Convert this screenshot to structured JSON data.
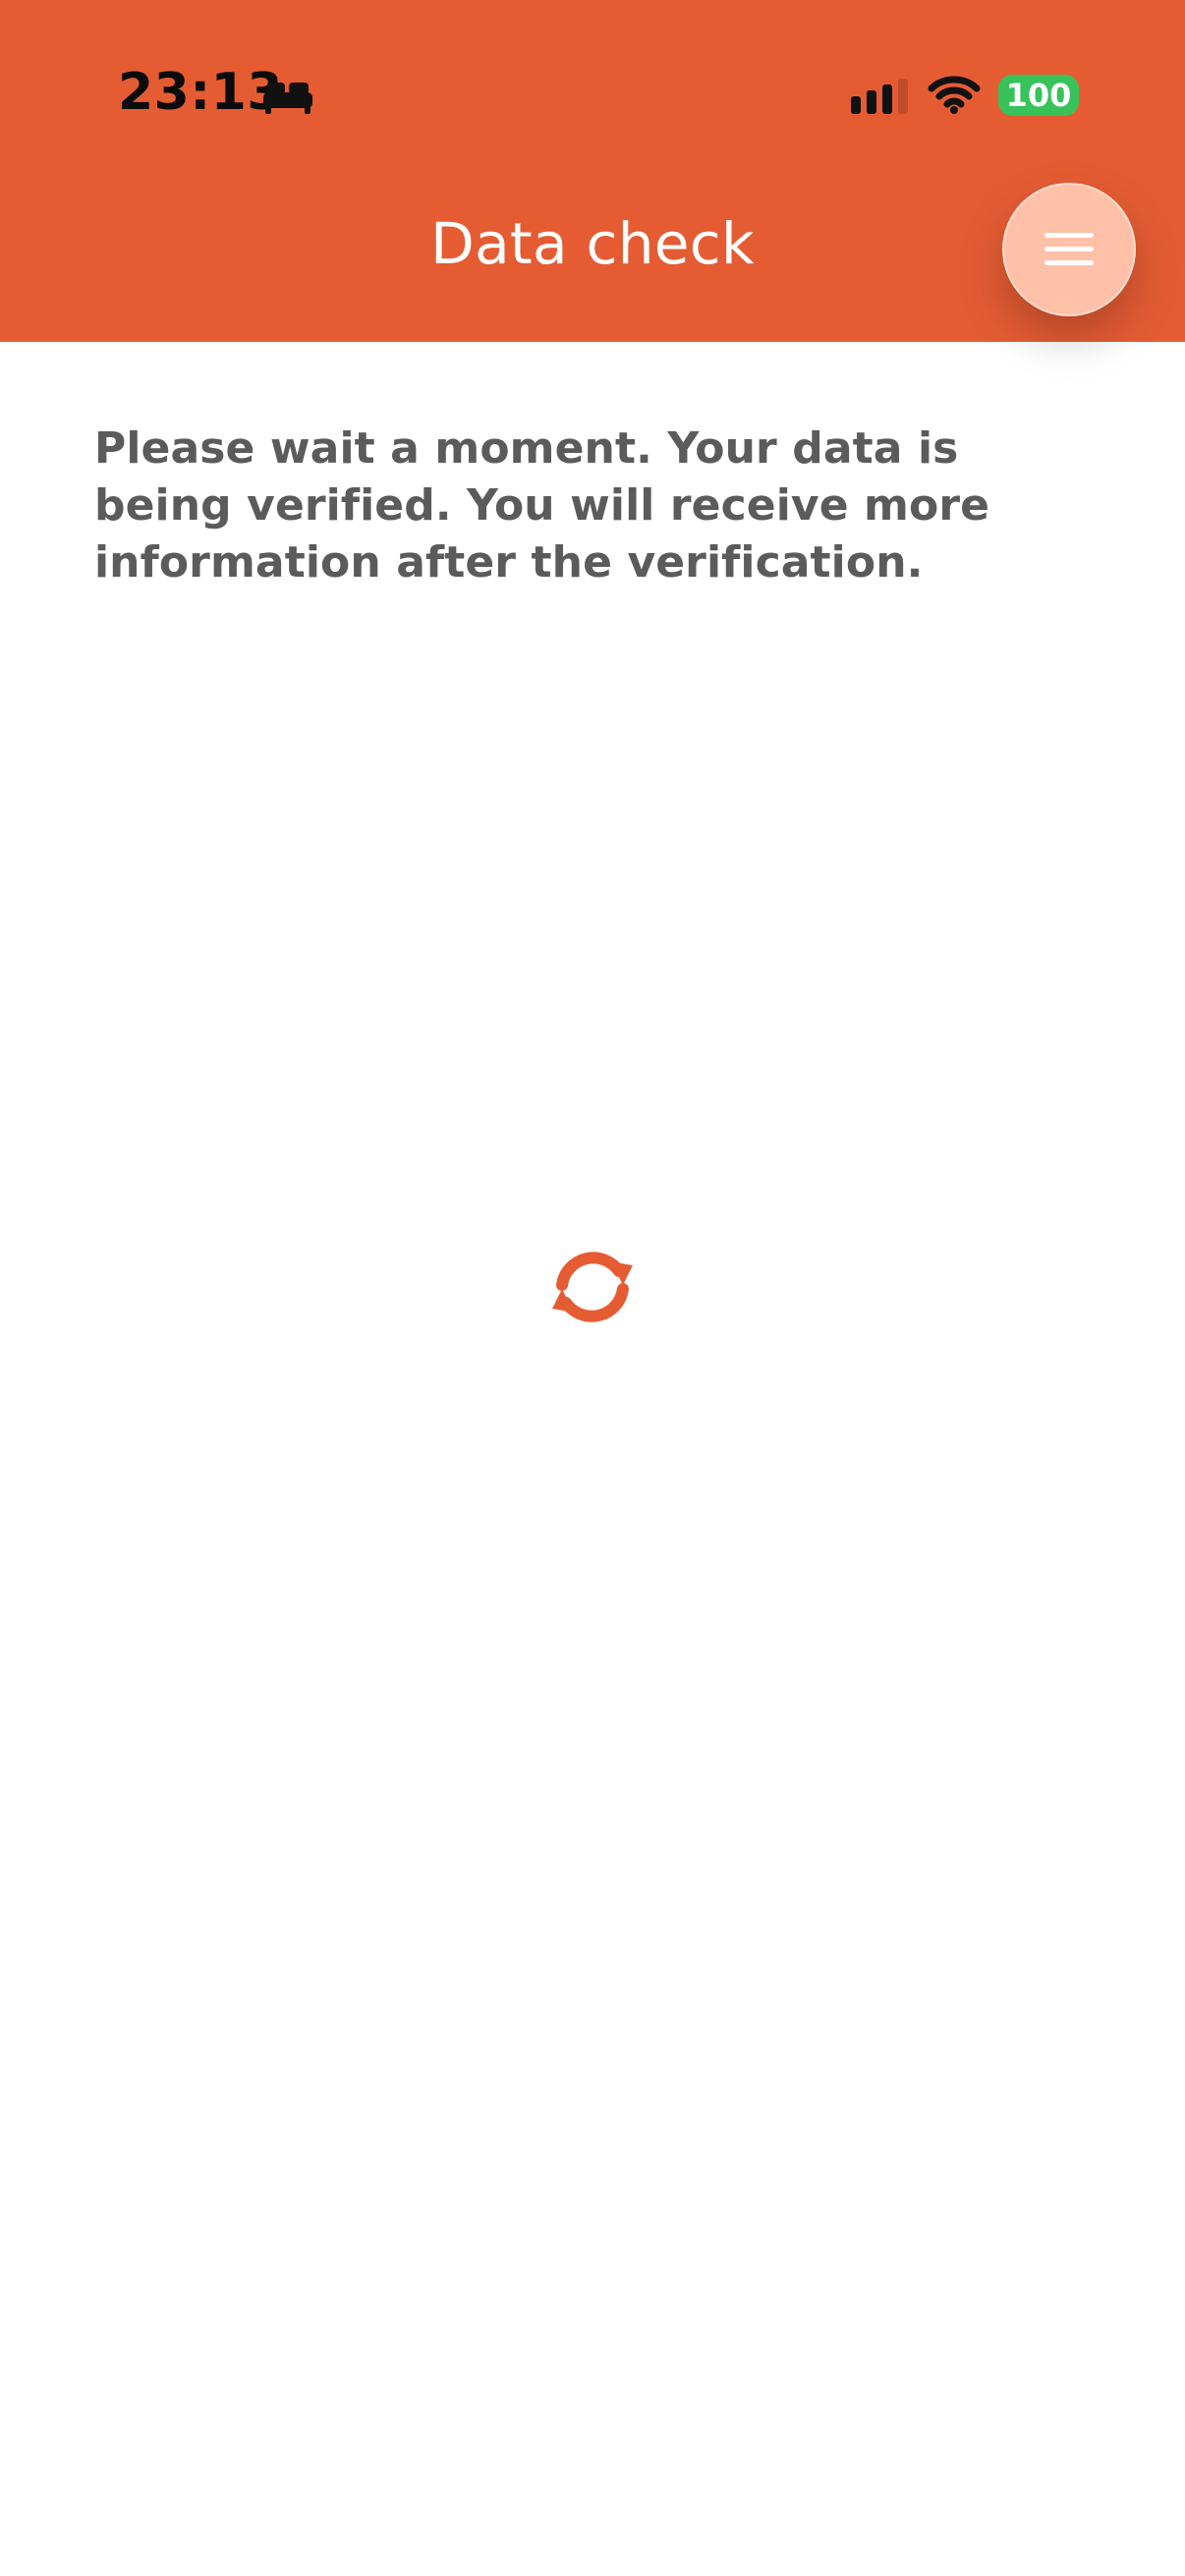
{
  "status_bar": {
    "time": "23:13",
    "battery": "100",
    "icons": [
      "bed-icon",
      "cellular-signal-icon",
      "wifi-icon",
      "battery-icon"
    ]
  },
  "header": {
    "title": "Data check",
    "menu_icon": "hamburger-menu-icon",
    "background_color": "#e55c33"
  },
  "main": {
    "message": "Please wait a moment. Your data is being verified. You will receive more information after the verification.",
    "loading_icon": "refresh-icon"
  },
  "colors": {
    "accent": "#e55c33",
    "menu_button": "#ffc0a8",
    "battery": "#37c25a",
    "text": "#5b5b5b"
  }
}
